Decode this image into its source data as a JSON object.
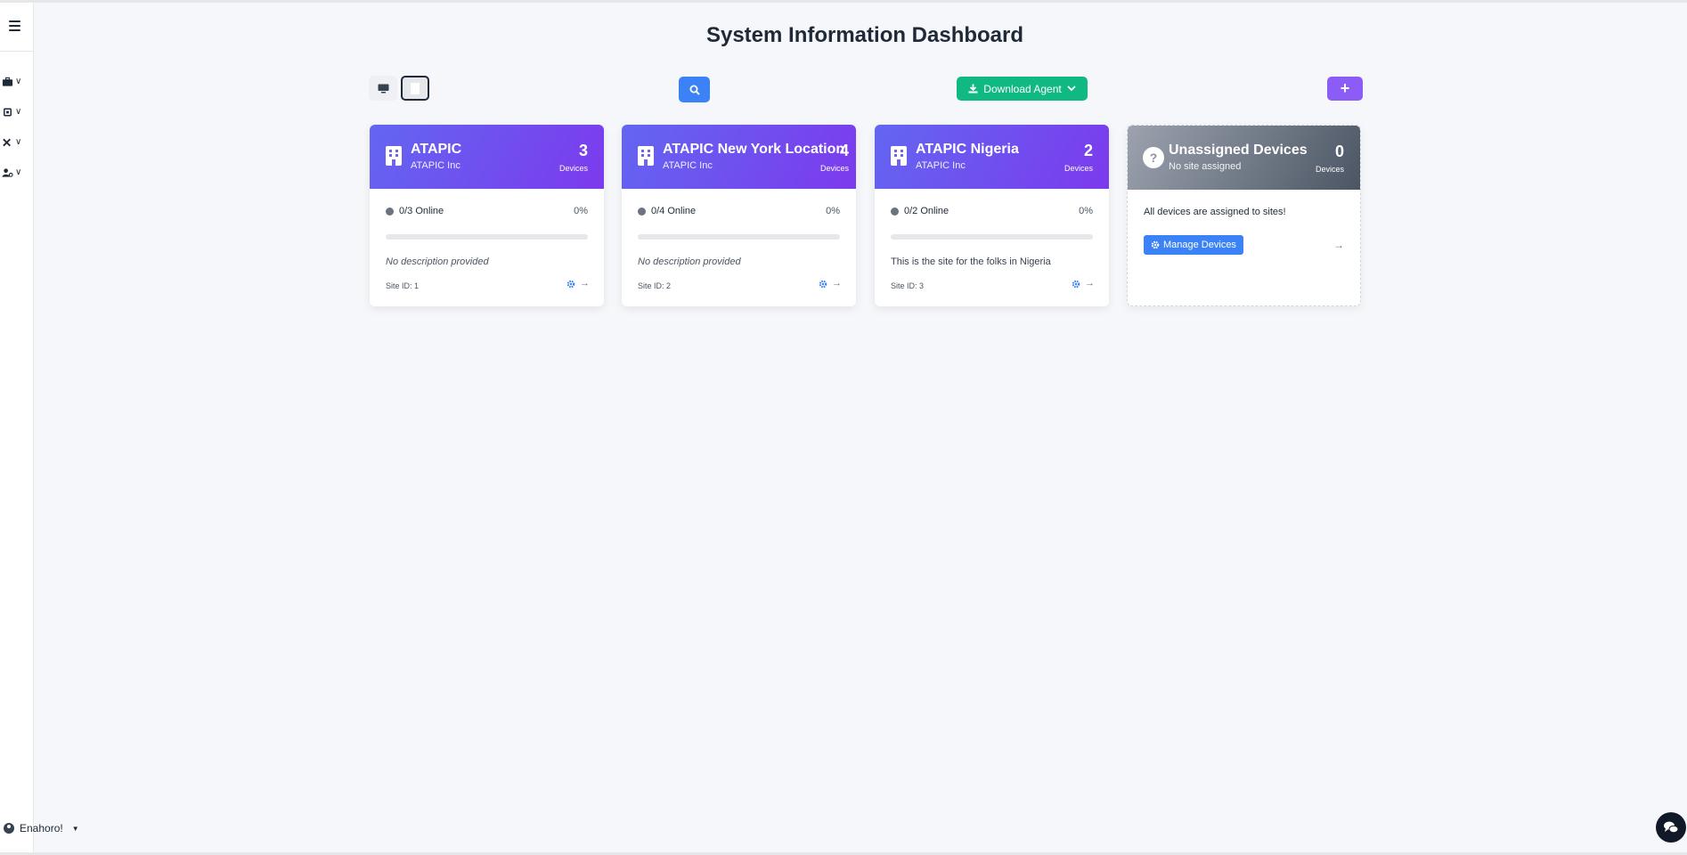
{
  "header": {
    "title": "System Information Dashboard"
  },
  "toolbar": {
    "download_label": "Download Agent",
    "add_label": "+"
  },
  "user": {
    "name": "Enahoro!"
  },
  "sites": [
    {
      "name": "ATAPIC",
      "company": "ATAPIC Inc",
      "device_count": "3",
      "devices_label": "Devices",
      "online": "0/3 Online",
      "percent": "0%",
      "online_fraction": 0,
      "description": "No description provided",
      "site_id": "Site ID: 1"
    },
    {
      "name": "ATAPIC New York Location",
      "company": "ATAPIC Inc",
      "device_count": "4",
      "devices_label": "Devices",
      "online": "0/4 Online",
      "percent": "0%",
      "online_fraction": 0,
      "description": "No description provided",
      "site_id": "Site ID: 2"
    },
    {
      "name": "ATAPIC Nigeria",
      "company": "ATAPIC Inc",
      "device_count": "2",
      "devices_label": "Devices",
      "online": "0/2 Online",
      "percent": "0%",
      "online_fraction": 0,
      "description": "This is the site for the folks in Nigeria",
      "site_id": "Site ID: 3"
    }
  ],
  "unassigned": {
    "title": "Unassigned Devices",
    "subtitle": "No site assigned",
    "count": "0",
    "devices_label": "Devices",
    "message": "All devices are assigned to sites!",
    "manage_label": "Manage Devices"
  },
  "colors": {
    "site_header_gradient": [
      "#6366f1",
      "#7c3aed"
    ],
    "unassigned_header_gradient": [
      "#9ca3af",
      "#4b5563"
    ],
    "search": "#3b82f6",
    "download": "#10b981",
    "add": "#8b5cf6"
  }
}
